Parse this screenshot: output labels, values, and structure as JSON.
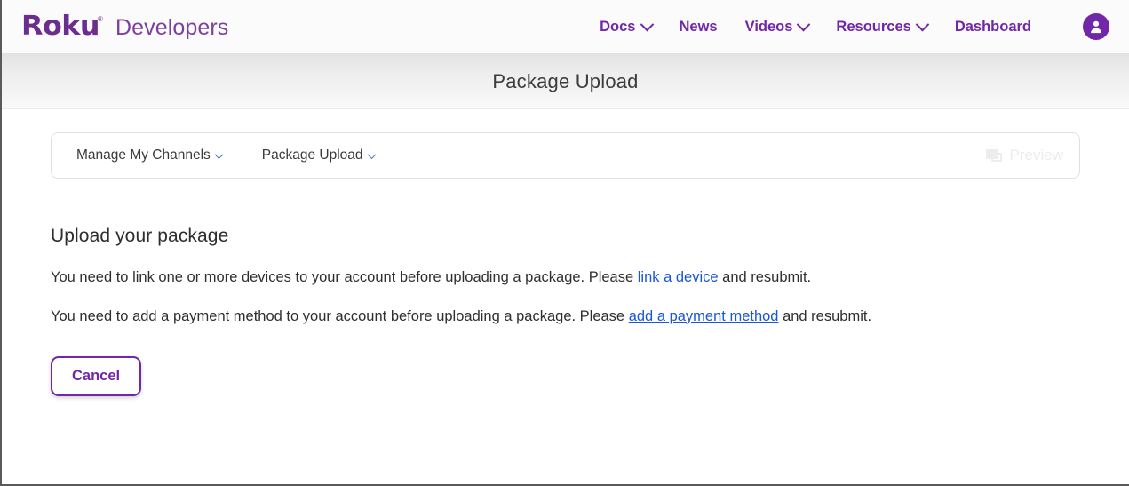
{
  "brand": {
    "wordmark": "Roku",
    "trademark": "®",
    "subtitle": "Developers"
  },
  "nav": {
    "items": [
      {
        "label": "Docs",
        "has_dropdown": true
      },
      {
        "label": "News",
        "has_dropdown": false
      },
      {
        "label": "Videos",
        "has_dropdown": true
      },
      {
        "label": "Resources",
        "has_dropdown": true
      },
      {
        "label": "Dashboard",
        "has_dropdown": false
      }
    ],
    "avatar_icon": "user-account-icon"
  },
  "banner": {
    "title": "Package Upload"
  },
  "breadcrumb": {
    "items": [
      {
        "label": "Manage My Channels",
        "has_dropdown": true
      },
      {
        "label": "Package Upload",
        "has_dropdown": true
      }
    ],
    "preview": {
      "label": "Preview",
      "icon": "monitor-preview-icon",
      "disabled": true
    }
  },
  "main": {
    "heading": "Upload your package",
    "messages": [
      {
        "before": "You need to link one or more devices to your account before uploading a package. Please ",
        "link": "link a device",
        "after": " and resubmit."
      },
      {
        "before": "You need to add a payment method to your account before uploading a package. Please ",
        "link": "add a payment method",
        "after": " and resubmit."
      }
    ],
    "cancel_label": "Cancel"
  },
  "colors": {
    "brand_purple": "#7226a8",
    "logo_purple": "#6b2d8e",
    "link_blue": "#1a56d6",
    "banner_text": "#3c3c3c"
  }
}
